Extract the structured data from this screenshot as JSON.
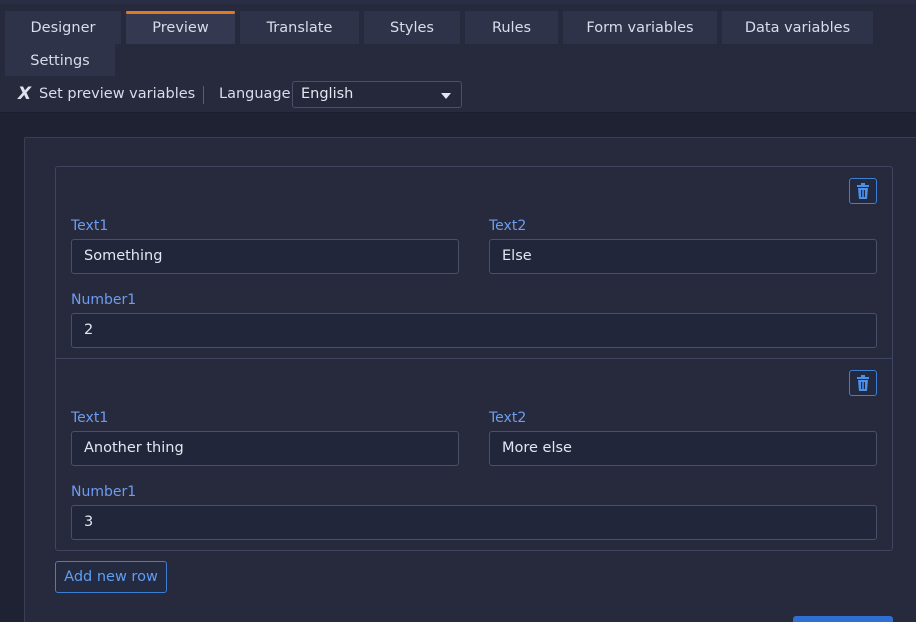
{
  "tabs": [
    {
      "label": "Designer",
      "active": false
    },
    {
      "label": "Preview",
      "active": true
    },
    {
      "label": "Translate",
      "active": false
    },
    {
      "label": "Styles",
      "active": false
    },
    {
      "label": "Rules",
      "active": false
    },
    {
      "label": "Form variables",
      "active": false
    },
    {
      "label": "Data variables",
      "active": false
    },
    {
      "label": "Settings",
      "active": false
    }
  ],
  "toolbar": {
    "set_preview_label": "Set preview variables",
    "language_label": "Language",
    "language_value": "English"
  },
  "rows": [
    {
      "text1_label": "Text1",
      "text1_value": "Something",
      "text2_label": "Text2",
      "text2_value": "Else",
      "number1_label": "Number1",
      "number1_value": "2"
    },
    {
      "text1_label": "Text1",
      "text1_value": "Another thing",
      "text2_label": "Text2",
      "text2_value": "More else",
      "number1_label": "Number1",
      "number1_value": "3"
    }
  ],
  "add_row_label": "Add new row",
  "colors": {
    "accent": "#3c7fd4",
    "active_tab_indicator": "#e07a22",
    "label_blue": "#6f9cf0"
  },
  "icons": {
    "set_preview": "variable-x-icon",
    "language_caret": "caret-down-icon",
    "delete": "trash-icon"
  }
}
